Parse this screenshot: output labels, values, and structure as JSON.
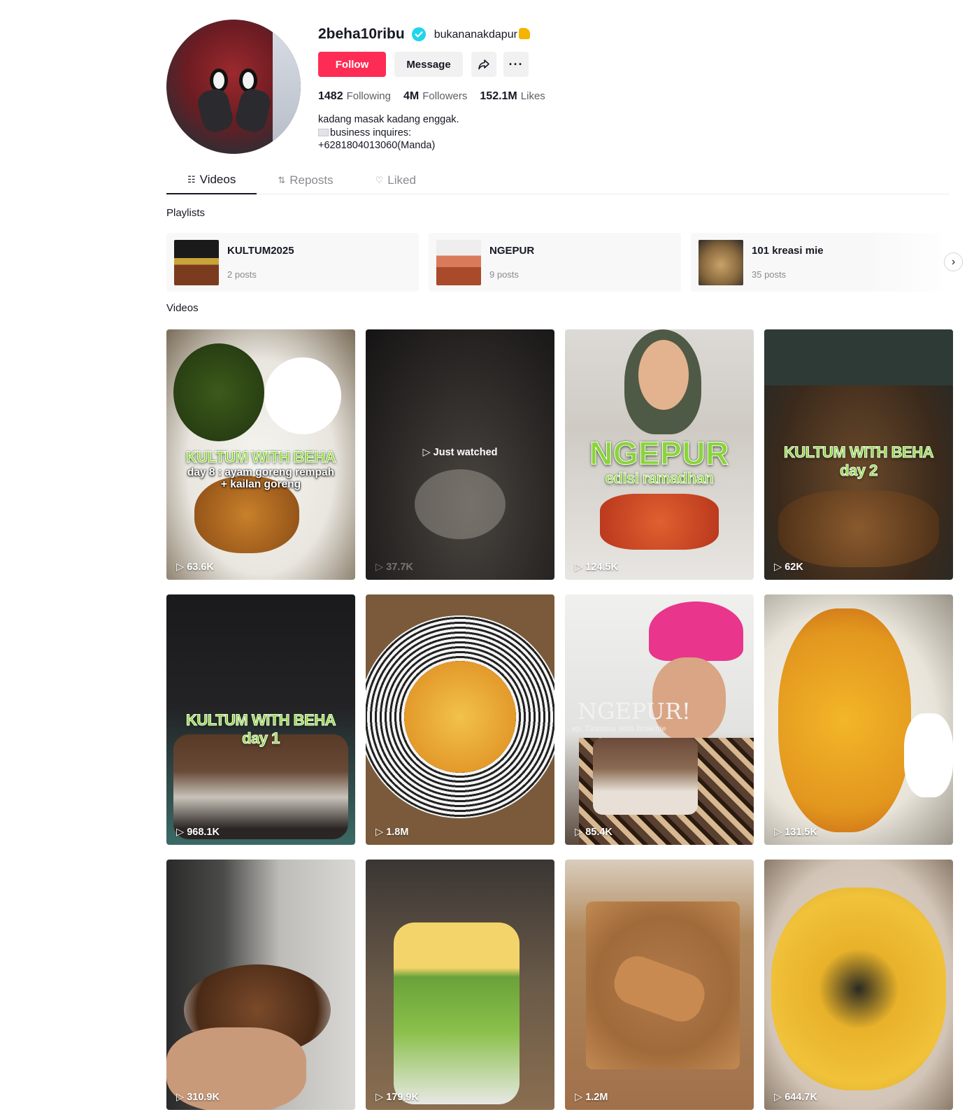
{
  "profile": {
    "username": "2beha10ribu",
    "nickname": "bukananakdapur",
    "follow_label": "Follow",
    "message_label": "Message",
    "more_label": "···",
    "stats": {
      "following_count": "1482",
      "following_label": "Following",
      "followers_count": "4M",
      "followers_label": "Followers",
      "likes_count": "152.1M",
      "likes_label": "Likes"
    },
    "bio_line1": "kadang masak kadang enggak.",
    "bio_line2": "business inquires:",
    "bio_line3": "+6281804013060(Manda)"
  },
  "tabs": {
    "videos": "Videos",
    "reposts": "Reposts",
    "liked": "Liked"
  },
  "playlists_title": "Playlists",
  "playlists": [
    {
      "title": "KULTUM2025",
      "count": "2 posts"
    },
    {
      "title": "NGEPUR",
      "count": "9 posts"
    },
    {
      "title": "101 kreasi mie",
      "count": "35 posts"
    }
  ],
  "videos_title": "Videos",
  "videos": [
    {
      "views": "63.6K",
      "overlay": "KULTUM WITH BEHA",
      "subtitle1": "day 8 : ayam goreng rempah",
      "subtitle2": "+ kailan goreng"
    },
    {
      "views": "37.7K",
      "watched": "▷ Just watched"
    },
    {
      "views": "124.5K",
      "overlay": "NGEPUR",
      "overlay2": "edisi ramadhan"
    },
    {
      "views": "62K",
      "overlay": "KULTUM WITH BEHA",
      "overlay2": "day 2"
    },
    {
      "views": "968.1K",
      "overlay": "KULTUM WITH BEHA",
      "overlay2": "day 1"
    },
    {
      "views": "1.8M"
    },
    {
      "views": "85.4K",
      "overlay": "NGEPUR!",
      "overlay2": "ep. Tiramisu with Brownie"
    },
    {
      "views": "131.5K"
    },
    {
      "views": "310.9K"
    },
    {
      "views": "179.9K"
    },
    {
      "views": "1.2M"
    },
    {
      "views": "644.7K"
    }
  ],
  "colors": {
    "follow_button": "#fe2c55",
    "verified_badge": "#20d5ec",
    "text_primary": "#161823",
    "text_secondary": "#8a8b91"
  }
}
